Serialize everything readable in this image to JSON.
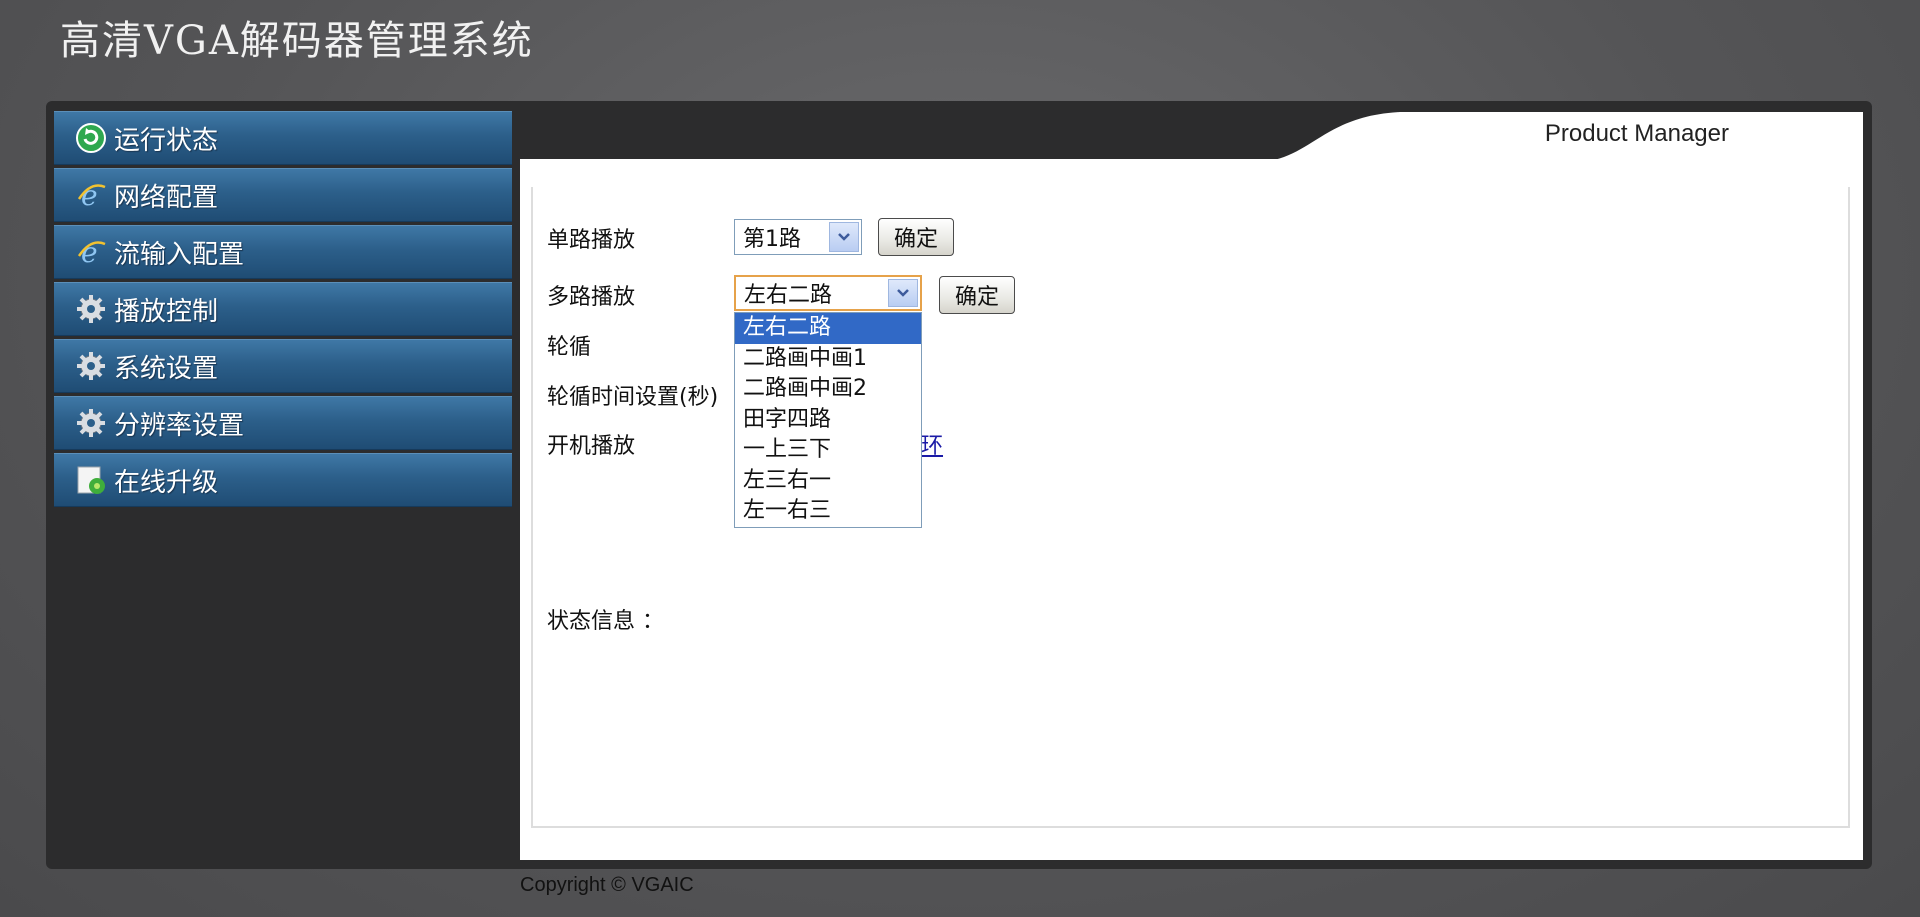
{
  "app": {
    "title": "高清VGA解码器管理系统"
  },
  "sidebar": {
    "items": [
      {
        "label": "运行状态"
      },
      {
        "label": "网络配置"
      },
      {
        "label": "流输入配置"
      },
      {
        "label": "播放控制"
      },
      {
        "label": "系统设置"
      },
      {
        "label": "分辨率设置"
      },
      {
        "label": "在线升级"
      }
    ]
  },
  "tab": {
    "label": "Product Manager"
  },
  "form": {
    "single_play": {
      "label": "单路播放",
      "selected": "第1路",
      "button": "确定"
    },
    "multi_play": {
      "label": "多路播放",
      "selected": "左右二路",
      "button": "确定",
      "options": [
        "左右二路",
        "二路画中画1",
        "二路画中画2",
        "田字四路",
        "一上三下",
        "左三右一",
        "左一右三"
      ]
    },
    "rotate": {
      "label": "轮循"
    },
    "rotate_time": {
      "label": "轮循时间设置(秒)"
    },
    "boot_play": {
      "label": "开机播放",
      "link_tail": "环"
    },
    "status": {
      "label": "状态信息 ："
    }
  },
  "footer": {
    "copyright": "Copyright © VGAIC"
  },
  "colors": {
    "sidebar_blue": "#2c5f8a",
    "selected_option": "#3169c6",
    "focus_border": "#e6a24a"
  }
}
